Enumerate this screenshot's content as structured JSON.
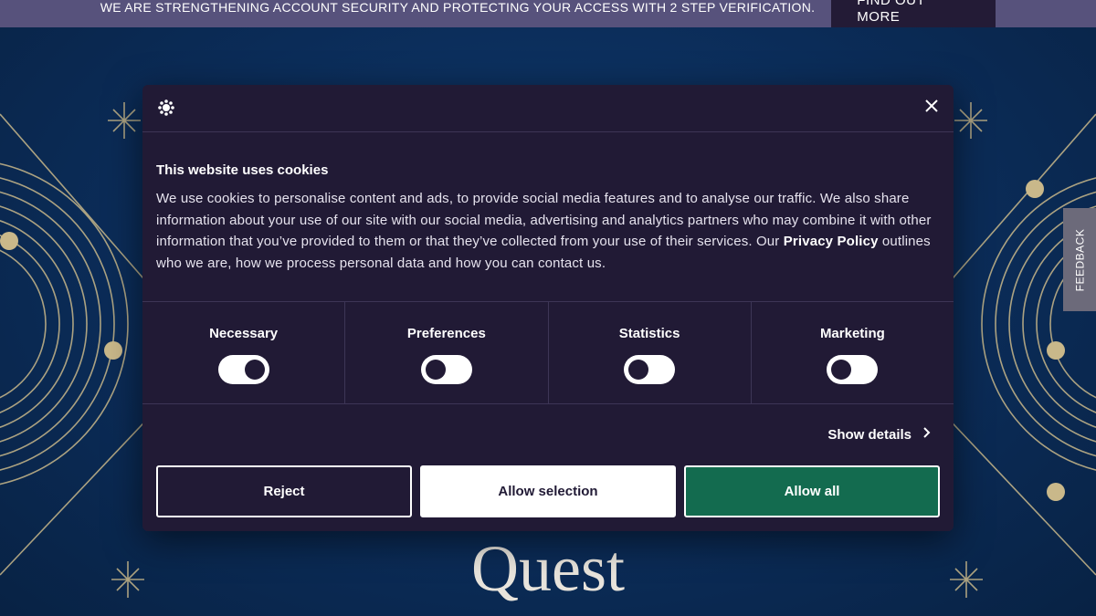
{
  "topbar": {
    "message": "WE ARE STRENGTHENING ACCOUNT SECURITY AND PROTECTING YOUR ACCESS WITH 2 STEP VERIFICATION.",
    "button_label": "FIND OUT MORE"
  },
  "hero": {
    "title": "Quest"
  },
  "feedback": {
    "label": "FEEDBACK"
  },
  "cookie_dialog": {
    "heading": "This website uses cookies",
    "body_before_link": "We use cookies to personalise content and ads, to provide social media features and to analyse our traffic. We also share information about your use of our site with our social media, advertising and analytics partners who may combine it with other information that you’ve provided to them or that they’ve collected from your use of their services. Our ",
    "link_label": "Privacy Policy",
    "body_after_link": " outlines who we are, how we process personal data and how you can contact us.",
    "categories": [
      {
        "label": "Necessary",
        "enabled": true
      },
      {
        "label": "Preferences",
        "enabled": false
      },
      {
        "label": "Statistics",
        "enabled": false
      },
      {
        "label": "Marketing",
        "enabled": false
      }
    ],
    "show_details_label": "Show details",
    "buttons": {
      "reject": "Reject",
      "allow_selection": "Allow selection",
      "allow_all": "Allow all"
    }
  },
  "colors": {
    "topbar_bg": "#57527c",
    "dialog_bg": "#211a35",
    "allow_all_bg": "#136b4f",
    "hero_bg": "#0c2c55",
    "ornament": "#c9b88a"
  },
  "icons": {
    "logo": "cookiebot-logo-icon",
    "close": "close-icon",
    "chevron": "chevron-right-icon"
  }
}
